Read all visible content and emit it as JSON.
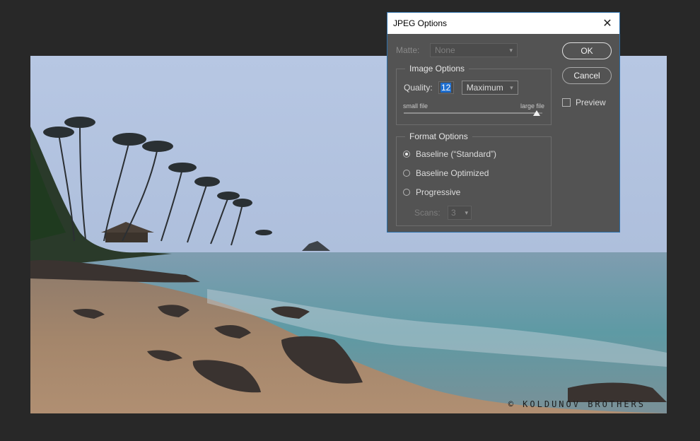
{
  "canvas": {
    "watermark": "© KOLDUNOV BROTHERS"
  },
  "dialog": {
    "title": "JPEG Options",
    "matte": {
      "label": "Matte:",
      "value": "None",
      "enabled": false
    },
    "buttons": {
      "ok": "OK",
      "cancel": "Cancel"
    },
    "preview": {
      "label": "Preview",
      "checked": false
    },
    "image_options": {
      "title": "Image Options",
      "quality_label": "Quality:",
      "quality_value": "12",
      "quality_preset": "Maximum",
      "slider_min_label": "small file",
      "slider_max_label": "large file",
      "slider_level": 0.96
    },
    "format_options": {
      "title": "Format Options",
      "options": [
        {
          "label": "Baseline (“Standard”)",
          "selected": true
        },
        {
          "label": "Baseline Optimized",
          "selected": false
        },
        {
          "label": "Progressive",
          "selected": false
        }
      ],
      "scans_label": "Scans:",
      "scans_value": "3",
      "scans_enabled": false
    }
  },
  "colors": {
    "dialog_bg": "#535353",
    "app_bg": "#282828",
    "accent": "#1f6fd0"
  }
}
